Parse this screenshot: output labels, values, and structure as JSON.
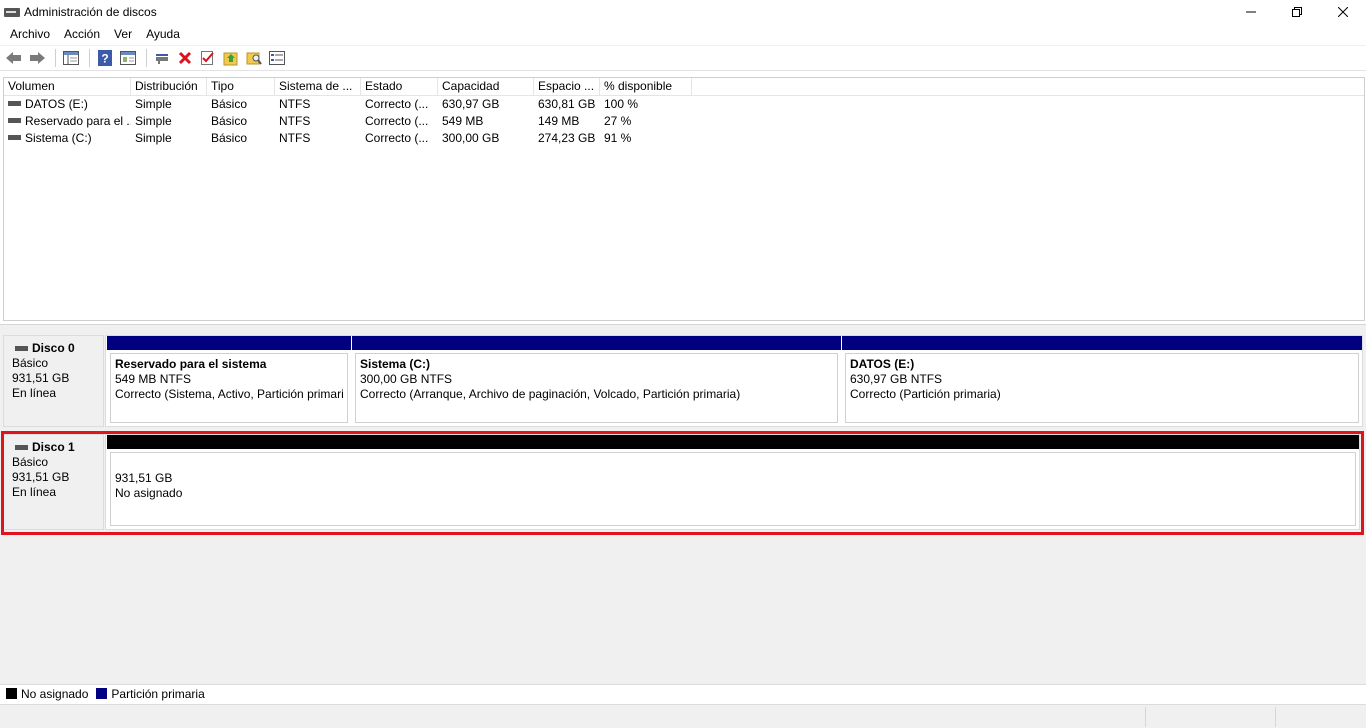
{
  "window": {
    "title": "Administración de discos"
  },
  "menu": [
    {
      "label": "Archivo"
    },
    {
      "label": "Acción"
    },
    {
      "label": "Ver"
    },
    {
      "label": "Ayuda"
    }
  ],
  "toolbar": {
    "buttons": [
      "back-icon",
      "forward-icon",
      "console-tree-icon",
      "help-icon",
      "properties-icon",
      "connect-icon",
      "delete-icon",
      "checkmark-icon",
      "folder-up-icon",
      "search-folder-icon",
      "list-view-icon"
    ]
  },
  "volume_table": {
    "columns": [
      "Volumen",
      "Distribución",
      "Tipo",
      "Sistema de ...",
      "Estado",
      "Capacidad",
      "Espacio ...",
      "% disponible"
    ],
    "rows": [
      [
        "DATOS (E:)",
        "Simple",
        "Básico",
        "NTFS",
        "Correcto (...",
        "630,97 GB",
        "630,81 GB",
        "100 %"
      ],
      [
        "Reservado para el ...",
        "Simple",
        "Básico",
        "NTFS",
        "Correcto (...",
        "549 MB",
        "149 MB",
        "27 %"
      ],
      [
        "Sistema (C:)",
        "Simple",
        "Básico",
        "NTFS",
        "Correcto (...",
        "300,00 GB",
        "274,23 GB",
        "91 %"
      ]
    ]
  },
  "disks": [
    {
      "name": "Disco 0",
      "type": "Básico",
      "size": "931,51 GB",
      "status": "En línea",
      "partitions": [
        {
          "name": "Reservado para el sistema",
          "size": "549 MB NTFS",
          "status": "Correcto (Sistema, Activo, Partición primari",
          "color": "#000080"
        },
        {
          "name": "Sistema  (C:)",
          "size": "300,00 GB NTFS",
          "status": "Correcto (Arranque, Archivo de paginación, Volcado, Partición primaria)",
          "color": "#000080"
        },
        {
          "name": "DATOS  (E:)",
          "size": "630,97 GB NTFS",
          "status": "Correcto (Partición primaria)",
          "color": "#000080"
        }
      ]
    },
    {
      "name": "Disco 1",
      "type": "Básico",
      "size": "931,51 GB",
      "status": "En línea",
      "partitions": [
        {
          "size": "931,51 GB",
          "status": "No asignado",
          "color": "#000000"
        }
      ]
    }
  ],
  "legend": [
    {
      "label": "No asignado",
      "color": "#000000"
    },
    {
      "label": "Partición primaria",
      "color": "#000080"
    }
  ],
  "colors": {
    "highlight": "#e0141e",
    "primary_partition": "#000080",
    "unallocated": "#000000"
  }
}
